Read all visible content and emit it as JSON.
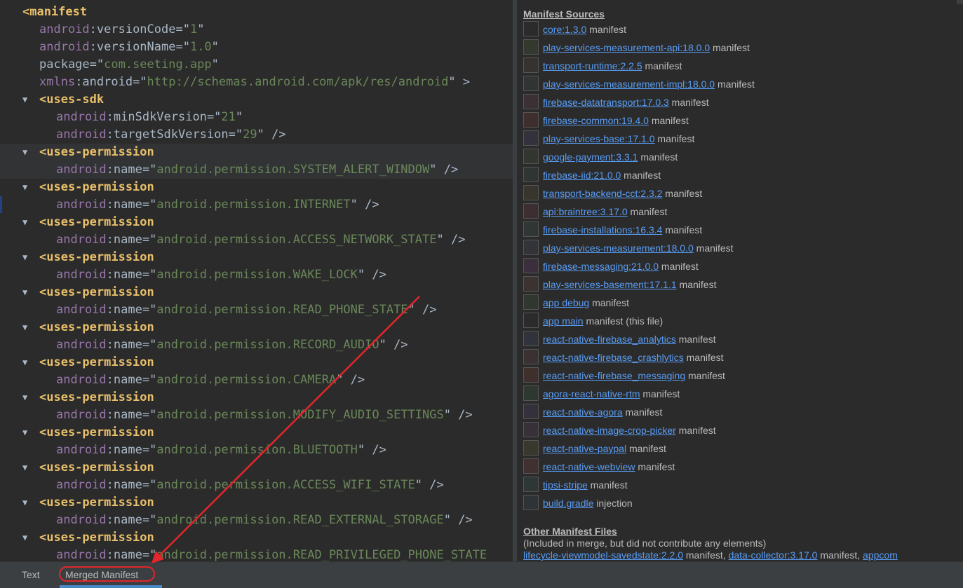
{
  "editor": {
    "lines": [
      [
        {
          "t": "<manifest",
          "c": "tag"
        }
      ],
      [
        {
          "t": "android",
          "c": "ns"
        },
        {
          "t": ":versionCode=\"",
          "c": "plain"
        },
        {
          "t": "1",
          "c": "str"
        },
        {
          "t": "\"",
          "c": "plain"
        }
      ],
      [
        {
          "t": "android",
          "c": "ns"
        },
        {
          "t": ":versionName=\"",
          "c": "plain"
        },
        {
          "t": "1.0",
          "c": "str"
        },
        {
          "t": "\"",
          "c": "plain"
        }
      ],
      [
        {
          "t": "package=\"",
          "c": "plain"
        },
        {
          "t": "com.seeting.app",
          "c": "str"
        },
        {
          "t": "\"",
          "c": "plain"
        }
      ],
      [
        {
          "t": "xmlns",
          "c": "ns"
        },
        {
          "t": ":android=\"",
          "c": "plain"
        },
        {
          "t": "http://schemas.android.com/apk/res/android",
          "c": "str"
        },
        {
          "t": "\" >",
          "c": "plain"
        }
      ],
      [
        {
          "t": "<uses-sdk",
          "c": "tag"
        }
      ],
      [
        {
          "t": "android",
          "c": "ns"
        },
        {
          "t": ":minSdkVersion=\"",
          "c": "plain"
        },
        {
          "t": "21",
          "c": "str"
        },
        {
          "t": "\"",
          "c": "plain"
        }
      ],
      [
        {
          "t": "android",
          "c": "ns"
        },
        {
          "t": ":targetSdkVersion=\"",
          "c": "plain"
        },
        {
          "t": "29",
          "c": "str"
        },
        {
          "t": "\" />",
          "c": "plain"
        }
      ],
      [
        {
          "t": "<uses-permission",
          "c": "tag"
        }
      ],
      [
        {
          "t": "android",
          "c": "ns"
        },
        {
          "t": ":name=\"",
          "c": "plain"
        },
        {
          "t": "android.permission.SYSTEM_ALERT_WINDOW",
          "c": "str"
        },
        {
          "t": "\" />",
          "c": "plain"
        }
      ],
      [
        {
          "t": "<uses-permission",
          "c": "tag"
        }
      ],
      [
        {
          "t": "android",
          "c": "ns"
        },
        {
          "t": ":name=\"",
          "c": "plain"
        },
        {
          "t": "android.permission.INTERNET",
          "c": "str"
        },
        {
          "t": "\" />",
          "c": "plain"
        }
      ],
      [
        {
          "t": "<uses-permission",
          "c": "tag"
        }
      ],
      [
        {
          "t": "android",
          "c": "ns"
        },
        {
          "t": ":name=\"",
          "c": "plain"
        },
        {
          "t": "android.permission.ACCESS_NETWORK_STATE",
          "c": "str"
        },
        {
          "t": "\" />",
          "c": "plain"
        }
      ],
      [
        {
          "t": "<uses-permission",
          "c": "tag"
        }
      ],
      [
        {
          "t": "android",
          "c": "ns"
        },
        {
          "t": ":name=\"",
          "c": "plain"
        },
        {
          "t": "android.permission.WAKE_LOCK",
          "c": "str"
        },
        {
          "t": "\" />",
          "c": "plain"
        }
      ],
      [
        {
          "t": "<uses-permission",
          "c": "tag"
        }
      ],
      [
        {
          "t": "android",
          "c": "ns"
        },
        {
          "t": ":name=\"",
          "c": "plain"
        },
        {
          "t": "android.permission.READ_PHONE_STATE",
          "c": "str"
        },
        {
          "t": "\" />",
          "c": "plain"
        }
      ],
      [
        {
          "t": "<uses-permission",
          "c": "tag"
        }
      ],
      [
        {
          "t": "android",
          "c": "ns"
        },
        {
          "t": ":name=\"",
          "c": "plain"
        },
        {
          "t": "android.permission.RECORD_AUDIO",
          "c": "str"
        },
        {
          "t": "\" />",
          "c": "plain"
        }
      ],
      [
        {
          "t": "<uses-permission",
          "c": "tag"
        }
      ],
      [
        {
          "t": "android",
          "c": "ns"
        },
        {
          "t": ":name=\"",
          "c": "plain"
        },
        {
          "t": "android.permission.CAMERA",
          "c": "str"
        },
        {
          "t": "\" />",
          "c": "plain"
        }
      ],
      [
        {
          "t": "<uses-permission",
          "c": "tag"
        }
      ],
      [
        {
          "t": "android",
          "c": "ns"
        },
        {
          "t": ":name=\"",
          "c": "plain"
        },
        {
          "t": "android.permission.MODIFY_AUDIO_SETTINGS",
          "c": "str"
        },
        {
          "t": "\" />",
          "c": "plain"
        }
      ],
      [
        {
          "t": "<uses-permission",
          "c": "tag"
        }
      ],
      [
        {
          "t": "android",
          "c": "ns"
        },
        {
          "t": ":name=\"",
          "c": "plain"
        },
        {
          "t": "android.permission.BLUETOOTH",
          "c": "str"
        },
        {
          "t": "\" />",
          "c": "plain"
        }
      ],
      [
        {
          "t": "<uses-permission",
          "c": "tag"
        }
      ],
      [
        {
          "t": "android",
          "c": "ns"
        },
        {
          "t": ":name=\"",
          "c": "plain"
        },
        {
          "t": "android.permission.ACCESS_WIFI_STATE",
          "c": "str"
        },
        {
          "t": "\" />",
          "c": "plain"
        }
      ],
      [
        {
          "t": "<uses-permission",
          "c": "tag"
        }
      ],
      [
        {
          "t": "android",
          "c": "ns"
        },
        {
          "t": ":name=\"",
          "c": "plain"
        },
        {
          "t": "android.permission.READ_EXTERNAL_STORAGE",
          "c": "str"
        },
        {
          "t": "\" />",
          "c": "plain"
        }
      ],
      [
        {
          "t": "<uses-permission",
          "c": "tag"
        }
      ],
      [
        {
          "t": "android",
          "c": "ns"
        },
        {
          "t": ":name=\"",
          "c": "plain"
        },
        {
          "t": "android.permission.READ_PRIVILEGED_PHONE_STATE",
          "c": "str"
        }
      ]
    ],
    "fold_glyph": "▼"
  },
  "sources": {
    "title": "Manifest Sources",
    "items": [
      {
        "link": "core:1.3.0",
        "suffix": " manifest",
        "swatch": "#2b2b2b"
      },
      {
        "link": "play-services-measurement-api:18.0.0",
        "suffix": " manifest",
        "swatch": "#34392f"
      },
      {
        "link": "transport-runtime:2.2.5",
        "suffix": " manifest",
        "swatch": "#36322f"
      },
      {
        "link": "play-services-measurement-impl:18.0.0",
        "suffix": " manifest",
        "swatch": "#303433"
      },
      {
        "link": "firebase-datatransport:17.0.3",
        "suffix": " manifest",
        "swatch": "#3b3033"
      },
      {
        "link": "firebase-common:19.4.0",
        "suffix": " manifest",
        "swatch": "#3e2f2c"
      },
      {
        "link": "play-services-base:17.1.0",
        "suffix": " manifest",
        "swatch": "#33323a"
      },
      {
        "link": "google-payment:3.3.1",
        "suffix": " manifest",
        "swatch": "#31372f"
      },
      {
        "link": "firebase-iid:21.0.0",
        "suffix": " manifest",
        "swatch": "#2f3533"
      },
      {
        "link": "transport-backend-cct:2.3.2",
        "suffix": " manifest",
        "swatch": "#38352c"
      },
      {
        "link": "api:braintree:3.17.0",
        "suffix": " manifest",
        "swatch": "#3d2e31"
      },
      {
        "link": "firebase-installations:16.3.4",
        "suffix": " manifest",
        "swatch": "#2f3634"
      },
      {
        "link": "play-services-measurement:18.0.0",
        "suffix": " manifest",
        "swatch": "#33343a"
      },
      {
        "link": "firebase-messaging:21.0.0",
        "suffix": " manifest",
        "swatch": "#3a2f3a"
      },
      {
        "link": "play-services-basement:17.1.1",
        "suffix": " manifest",
        "swatch": "#3a3330"
      },
      {
        "link": "app debug",
        "suffix": " manifest",
        "swatch": "#30372f"
      },
      {
        "link": "app main",
        "suffix": " manifest (this file)",
        "swatch": "#2b2b2b"
      },
      {
        "link": "react-native-firebase_analytics",
        "suffix": " manifest",
        "swatch": "#31333b"
      },
      {
        "link": "react-native-firebase_crashlytics",
        "suffix": " manifest",
        "swatch": "#3a3132"
      },
      {
        "link": "react-native-firebase_messaging",
        "suffix": " manifest",
        "swatch": "#40302d"
      },
      {
        "link": "agora-react-native-rtm",
        "suffix": " manifest",
        "swatch": "#2f3731"
      },
      {
        "link": "react-native-agora",
        "suffix": " manifest",
        "swatch": "#35313a"
      },
      {
        "link": "react-native-image-crop-picker",
        "suffix": " manifest",
        "swatch": "#373039"
      },
      {
        "link": "react-native-paypal",
        "suffix": " manifest",
        "swatch": "#39382d"
      },
      {
        "link": "react-native-webview",
        "suffix": " manifest",
        "swatch": "#40302f"
      },
      {
        "link": "tipsi-stripe",
        "suffix": " manifest",
        "swatch": "#2f3636"
      },
      {
        "link": "build.gradle",
        "suffix": " injection",
        "swatch": "#2e3338"
      }
    ]
  },
  "other": {
    "title": "Other Manifest Files",
    "note": "(Included in merge, but did not contribute any elements)",
    "files": [
      {
        "link": "lifecycle-viewmodel-savedstate:2.2.0",
        "suffix": " manifest, "
      },
      {
        "link": "data-collector:3.17.0",
        "suffix": " manifest, "
      },
      {
        "link": "appcom",
        "suffix": ""
      }
    ]
  },
  "tabs": {
    "text": "Text",
    "merged": "Merged Manifest"
  },
  "colors": {
    "annotation": "#e3262b",
    "link": "#589df6",
    "tag": "#e8bf6a",
    "attr_ns": "#9876aa",
    "string": "#6a8759"
  }
}
